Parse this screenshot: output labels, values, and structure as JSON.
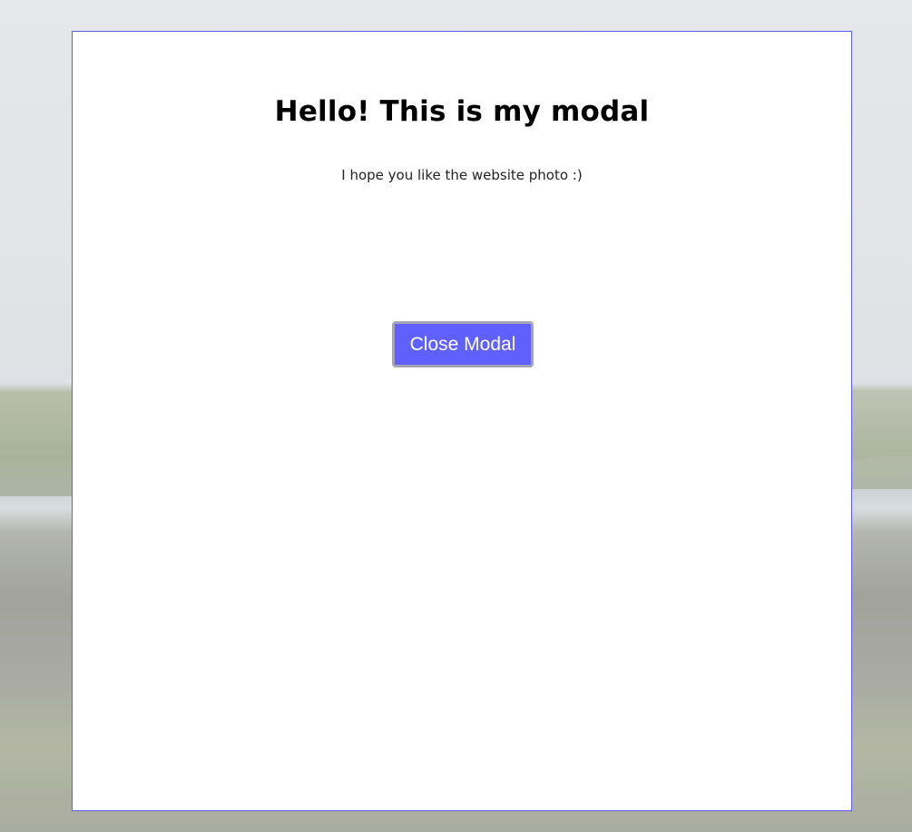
{
  "modal": {
    "title": "Hello! This is my modal",
    "text": "I hope you like the website photo :)",
    "close_label": "Close Modal",
    "accent_color": "#6060ff",
    "border_color": "#5b5bf5"
  }
}
